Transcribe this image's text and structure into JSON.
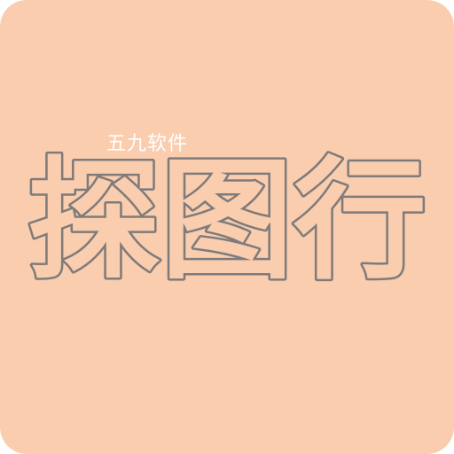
{
  "app_icon": {
    "background_color": "#f9cdae",
    "outline_color": "#7f7b7b",
    "watermark": "五九软件",
    "logo_text": "探图行"
  }
}
